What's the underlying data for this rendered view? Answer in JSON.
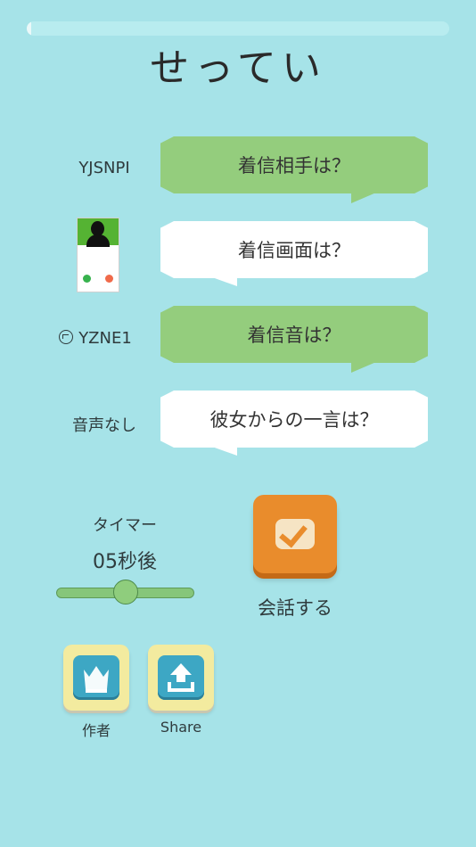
{
  "progress": {
    "fraction": 0.0
  },
  "page": {
    "title": "せってい"
  },
  "rows": [
    {
      "label": "YJSNPI",
      "button": "着信相手は？",
      "style": "green"
    },
    {
      "label": "",
      "button": "着信画面は？",
      "style": "white"
    },
    {
      "label": "YZNE1",
      "button": "着信音は？",
      "style": "green"
    },
    {
      "label": "音声なし",
      "button": "彼女からの一言は？",
      "style": "white"
    }
  ],
  "timer": {
    "title": "タイマー",
    "value_text": "05秒後",
    "slider_fraction": 0.5
  },
  "start": {
    "label": "会話する"
  },
  "footer": {
    "author_label": "作者",
    "share_label": "Share"
  },
  "colors": {
    "background": "#a6e3e8",
    "green_bubble": "#94cd7d",
    "orange": "#e98c2c",
    "tile": "#f3eb9f",
    "tile_icon": "#3da7c4"
  },
  "icons": [
    "sound-icon",
    "phone-thumbnail",
    "check-icon",
    "crown-icon",
    "share-upload-icon"
  ]
}
